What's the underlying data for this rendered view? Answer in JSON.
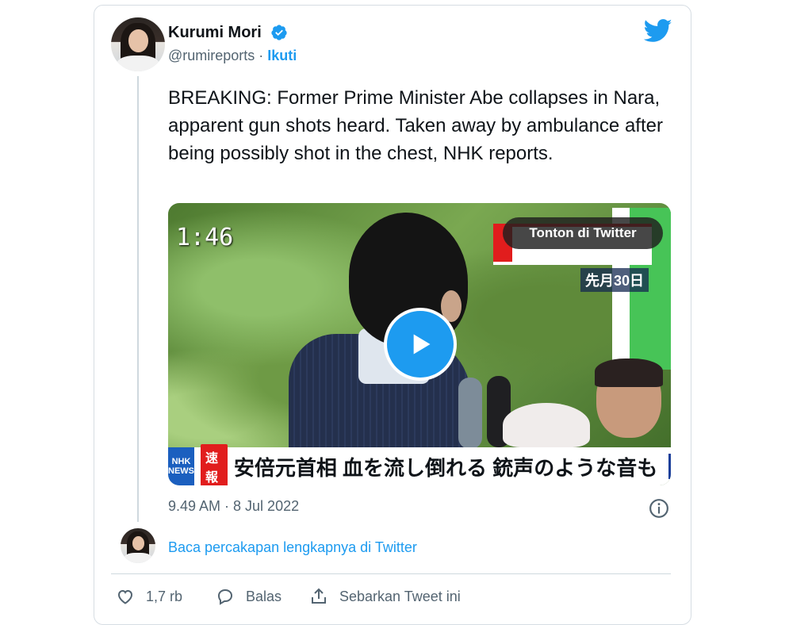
{
  "author": {
    "name": "Kurumi Mori",
    "handle": "@rumireports",
    "separator": " · ",
    "follow_label": "Ikuti"
  },
  "tweet": {
    "text": "BREAKING: Former Prime Minister Abe collapses in Nara, apparent gun shots heard. Taken away by ambulance after being possibly shot in the chest, NHK reports.",
    "timestamp": "9.49 AM · 8 Jul 2022"
  },
  "media": {
    "video_time": "1:46",
    "watch_label": "Tonton di Twitter",
    "date_tag": "先月30日",
    "channel_logo": "NHK NEWS",
    "breaking_badge": "速報",
    "ticker_text": "安倍元首相 血を流し倒れる 銃声のような音も"
  },
  "conversation": {
    "read_more_label": "Baca percakapan lengkapnya di Twitter"
  },
  "actions": {
    "like_count": "1,7 rb",
    "reply_label": "Balas",
    "share_label": "Sebarkan Tweet ini"
  },
  "icons": {
    "brand": "twitter-bird-icon",
    "verified": "verified-badge-icon",
    "info": "info-icon",
    "like": "heart-icon",
    "reply": "reply-bubble-icon",
    "share": "share-icon",
    "play": "play-icon"
  },
  "colors": {
    "accent": "#1d9bf0",
    "text": "#0f1419",
    "muted": "#536471",
    "border": "#cfd9de",
    "news_red": "#e11d1d"
  }
}
